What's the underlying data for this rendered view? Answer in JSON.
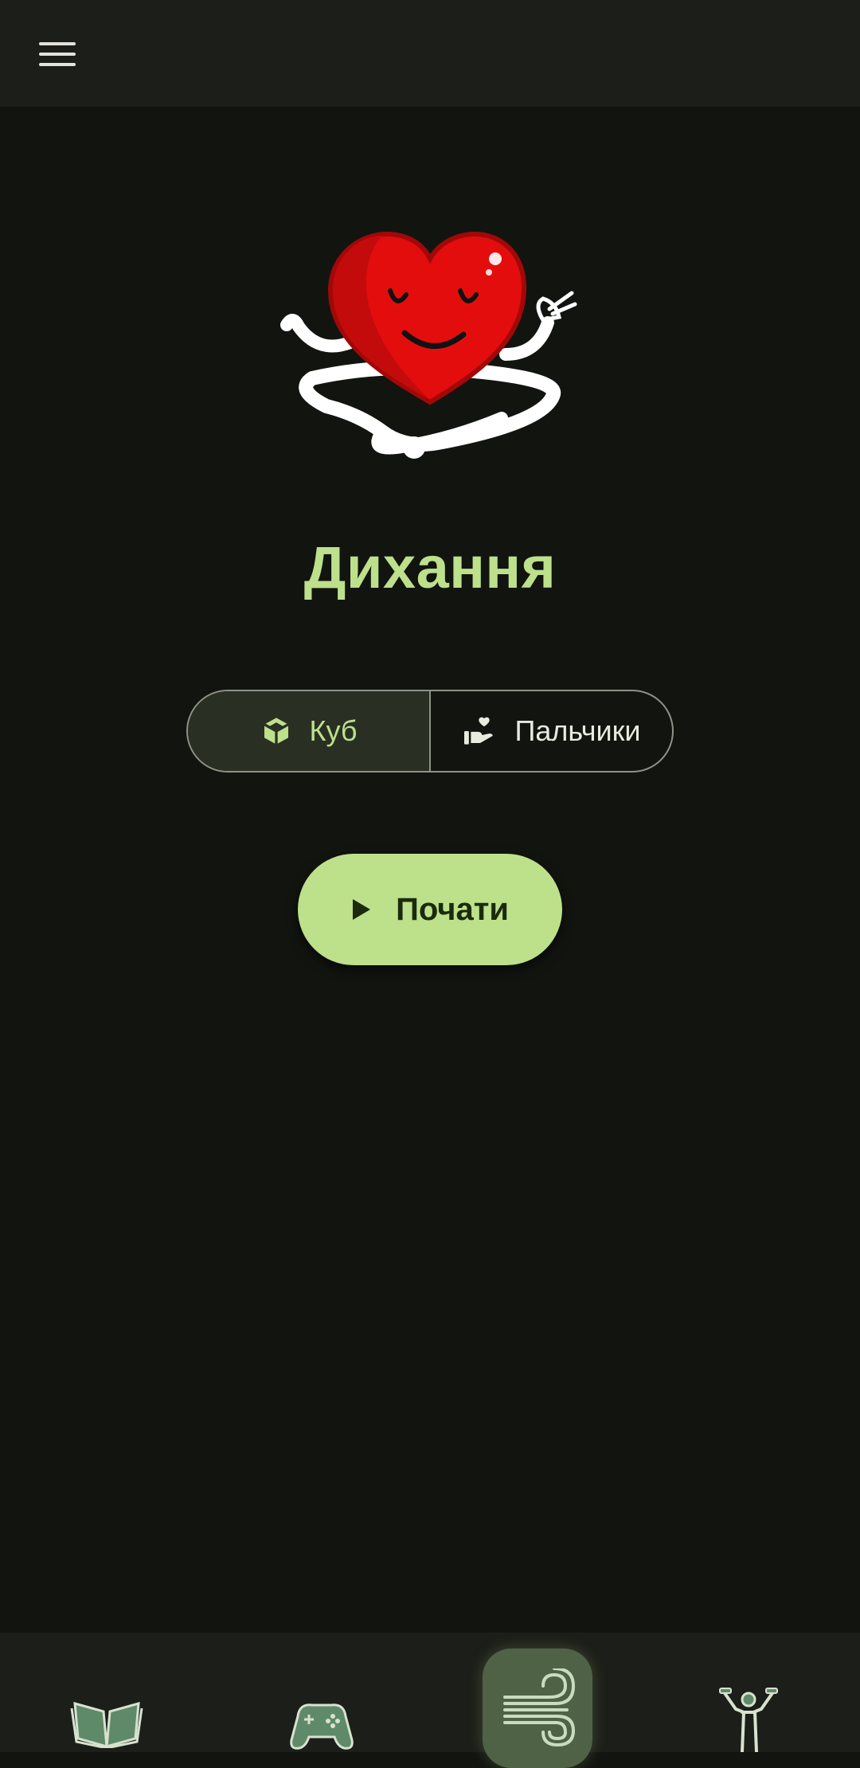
{
  "header": {
    "menu_icon": "hamburger-menu-icon"
  },
  "main": {
    "mascot": "meditating-heart-illustration",
    "title": "Дихання",
    "modes": [
      {
        "label": "Куб",
        "icon": "cube-icon",
        "selected": true
      },
      {
        "label": "Пальчики",
        "icon": "hand-heart-icon",
        "selected": false
      }
    ],
    "start_button": {
      "label": "Почати",
      "icon": "play-icon"
    }
  },
  "bottom_nav": [
    {
      "id": "reading",
      "icon": "book-icon",
      "selected": false
    },
    {
      "id": "games",
      "icon": "gamepad-icon",
      "selected": false
    },
    {
      "id": "breathing",
      "icon": "wind-icon",
      "selected": true
    },
    {
      "id": "exercise",
      "icon": "exercise-person-icon",
      "selected": false
    }
  ],
  "colors": {
    "background": "#121410",
    "bar": "#1c1e19",
    "accent": "#bde08b",
    "nav_icon": "#5f8a6a",
    "nav_active_bg": "#4f6245"
  }
}
